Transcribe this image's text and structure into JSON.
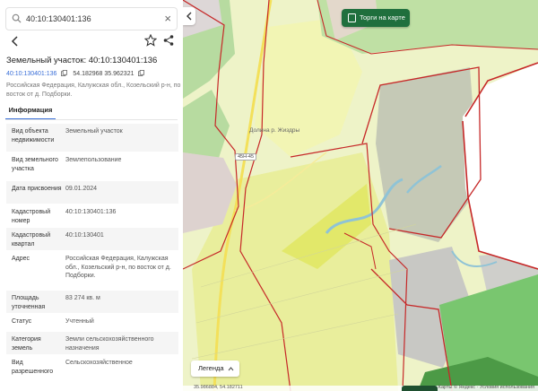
{
  "search": {
    "value": "40:10:130401:136"
  },
  "parcel": {
    "title": "Земельный участок: 40:10:130401:136",
    "cadastral_link": "40:10:130401:136",
    "coords": "54.182968 35.962321",
    "address": "Российская Федерация, Калужская обл., Козельский р-н, по восток от д. Подборки."
  },
  "tabs": {
    "info": "Информация"
  },
  "attributes": [
    {
      "key": "Вид объекта недвижимости",
      "value": "Земельный участок"
    },
    {
      "key": "Вид земельного участка",
      "value": "Землепользование"
    },
    {
      "key": "Дата присвоения",
      "value": "09.01.2024"
    },
    {
      "key": "Кадастровый номер",
      "value": "40:10:130401:136"
    },
    {
      "key": "Кадастровый квартал",
      "value": "40:10:130401"
    },
    {
      "key": "Адрес",
      "value": "Российская Федерация, Калужская обл., Козельский р-н, по восток от д. Подборки."
    },
    {
      "key": "Площадь уточненная",
      "value": "83 274 кв. м"
    },
    {
      "key": "Статус",
      "value": "Учтенный"
    },
    {
      "key": "Категория земель",
      "value": "Земли сельскохозяйственного назначения"
    },
    {
      "key": "Вид разрешенного",
      "value": "Сельскохозяйственное"
    }
  ],
  "map": {
    "trade_button": "Торги на карте",
    "legend_button": "Легенда",
    "place_label": "Долина р. Жиздры",
    "road_label": "45Н-45",
    "bottom_coords": "35.986884, 54.182711",
    "attribution": "Карты © Яндекс · Условия использования"
  },
  "colors": {
    "accent": "#3a6fd8",
    "trade_button": "#1f6f3d",
    "parcel_border": "#c62828",
    "field": "#eef3c8",
    "highlight": "#e6ea74",
    "forest": "#b7dba0",
    "grey_area": "#c3c8b8",
    "deep_green": "#79c66f"
  }
}
